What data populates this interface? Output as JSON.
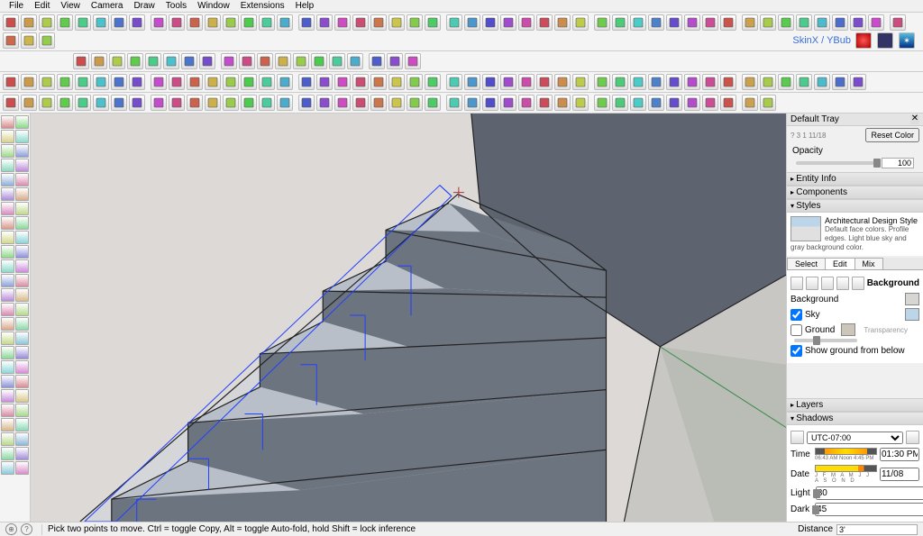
{
  "menubar": [
    "File",
    "Edit",
    "View",
    "Camera",
    "Draw",
    "Tools",
    "Window",
    "Extensions",
    "Help"
  ],
  "logo": {
    "text": "SkinX / YBub"
  },
  "tray": {
    "title": "Default Tray",
    "color_code": "? 3 1 11/18",
    "reset_btn": "Reset Color",
    "opacity_label": "Opacity",
    "opacity_value": "100",
    "panels": {
      "entity": "Entity Info",
      "components": "Components",
      "styles": "Styles",
      "layers": "Layers",
      "shadows": "Shadows"
    },
    "style_name": "Architectural Design Style",
    "style_desc": "Default face colors. Profile edges. Light blue sky and gray background color.",
    "tabs": [
      "Select",
      "Edit",
      "Mix"
    ],
    "background_label": "Background",
    "bg_label": "Background",
    "sky_label": "Sky",
    "ground_label": "Ground",
    "transparency_label": "Transparency",
    "show_ground_label": "Show ground from below"
  },
  "shadows": {
    "tz": "UTC-07:00",
    "time_label": "Time",
    "time_ticks": "06:43 AM  Noon  4:45 PM",
    "time_value": "01:30 PM",
    "date_label": "Date",
    "date_ticks": "J F M A M J J A S O N D",
    "date_value": "11/08",
    "light_label": "Light",
    "light_value": "80",
    "dark_label": "Dark",
    "dark_value": "45"
  },
  "status": {
    "hint": "Pick two points to move. Ctrl = toggle Copy, Alt = toggle Auto-fold, hold Shift = lock inference",
    "distance_label": "Distance",
    "distance_value": "3'"
  },
  "toolbar_counts": {
    "row1": 52,
    "row2": 19,
    "row3": 47,
    "row4": 42
  }
}
